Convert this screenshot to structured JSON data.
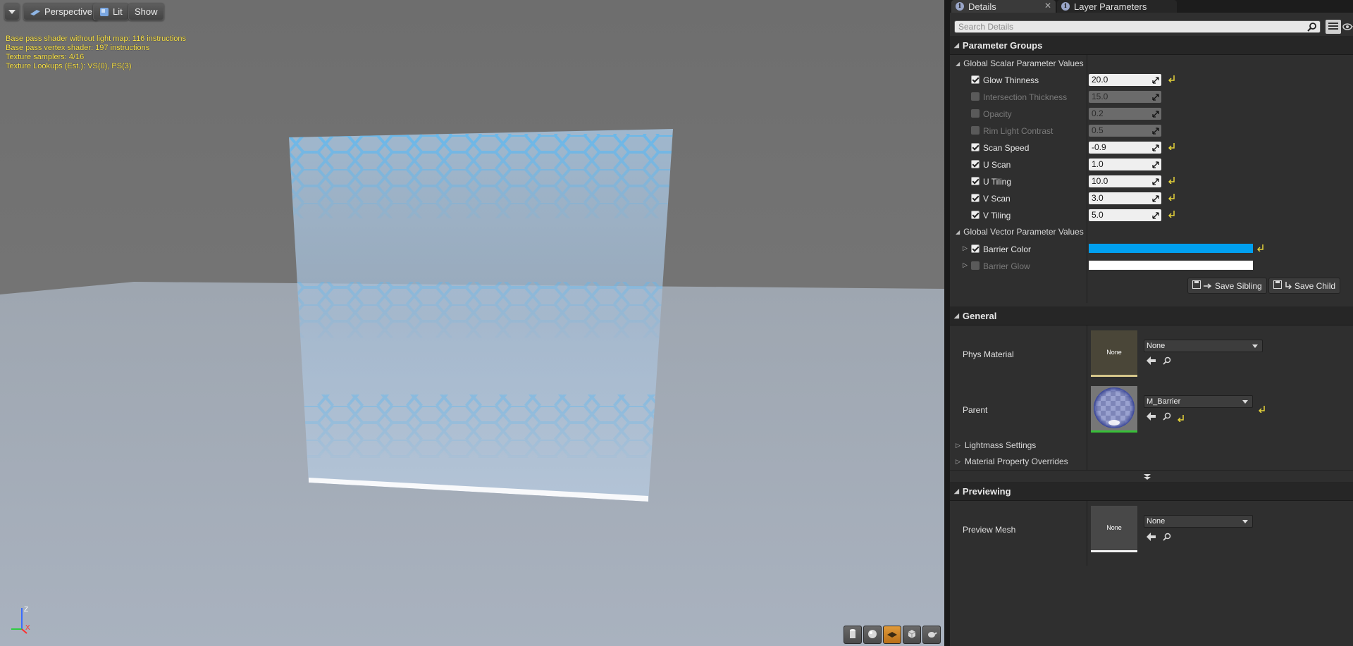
{
  "viewport": {
    "toolbar": {
      "menu_icon": "chevron-down-icon",
      "perspective_label": "Perspective",
      "lit_label": "Lit",
      "show_label": "Show"
    },
    "stats": [
      "Base pass shader without light map: 116 instructions",
      "Base pass vertex shader: 197 instructions",
      "Texture samplers: 4/16",
      "Texture Lookups (Est.): VS(0), PS(3)"
    ],
    "axis": {
      "z": "Z",
      "x": "X"
    },
    "preview_tools": [
      "cylinder-icon",
      "sphere-icon",
      "plane-icon",
      "cube-icon",
      "teapot-icon"
    ],
    "active_tool_index": 2
  },
  "tabs": {
    "details": "Details",
    "layer_parameters": "Layer Parameters",
    "close_glyph": "✕"
  },
  "search": {
    "placeholder": "Search Details"
  },
  "parameter_groups": {
    "title": "Parameter Groups",
    "scalar_title": "Global Scalar Parameter Values",
    "scalars": [
      {
        "label": "Glow Thinness",
        "value": "20.0",
        "enabled": true,
        "reset": true
      },
      {
        "label": "Intersection Thickness",
        "value": "15.0",
        "enabled": false,
        "reset": false
      },
      {
        "label": "Opacity",
        "value": "0.2",
        "enabled": false,
        "reset": false
      },
      {
        "label": "Rim Light Contrast",
        "value": "0.5",
        "enabled": false,
        "reset": false
      },
      {
        "label": "Scan Speed",
        "value": "-0.9",
        "enabled": true,
        "reset": true
      },
      {
        "label": "U Scan",
        "value": "1.0",
        "enabled": true,
        "reset": false
      },
      {
        "label": "U Tiling",
        "value": "10.0",
        "enabled": true,
        "reset": true
      },
      {
        "label": "V Scan",
        "value": "3.0",
        "enabled": true,
        "reset": true
      },
      {
        "label": "V Tiling",
        "value": "5.0",
        "enabled": true,
        "reset": true
      }
    ],
    "vector_title": "Global Vector Parameter Values",
    "vectors": [
      {
        "label": "Barrier Color",
        "color": "#00a0f0",
        "enabled": true,
        "reset": true
      },
      {
        "label": "Barrier Glow",
        "color": "#ffffff",
        "enabled": false,
        "reset": false
      }
    ],
    "save_sibling": "Save Sibling",
    "save_child": "Save Child"
  },
  "general": {
    "title": "General",
    "phys_material": {
      "label": "Phys Material",
      "thumb_text": "None",
      "value": "None"
    },
    "parent": {
      "label": "Parent",
      "value": "M_Barrier"
    },
    "lightmass": "Lightmass Settings",
    "material_overrides": "Material Property Overrides"
  },
  "previewing": {
    "title": "Previewing",
    "preview_mesh": {
      "label": "Preview Mesh",
      "thumb_text": "None",
      "value": "None"
    }
  },
  "colors": {
    "accent_reset": "#e6d43a",
    "panel_bg": "#2f2f2f",
    "stats_text": "#ffe84d"
  }
}
